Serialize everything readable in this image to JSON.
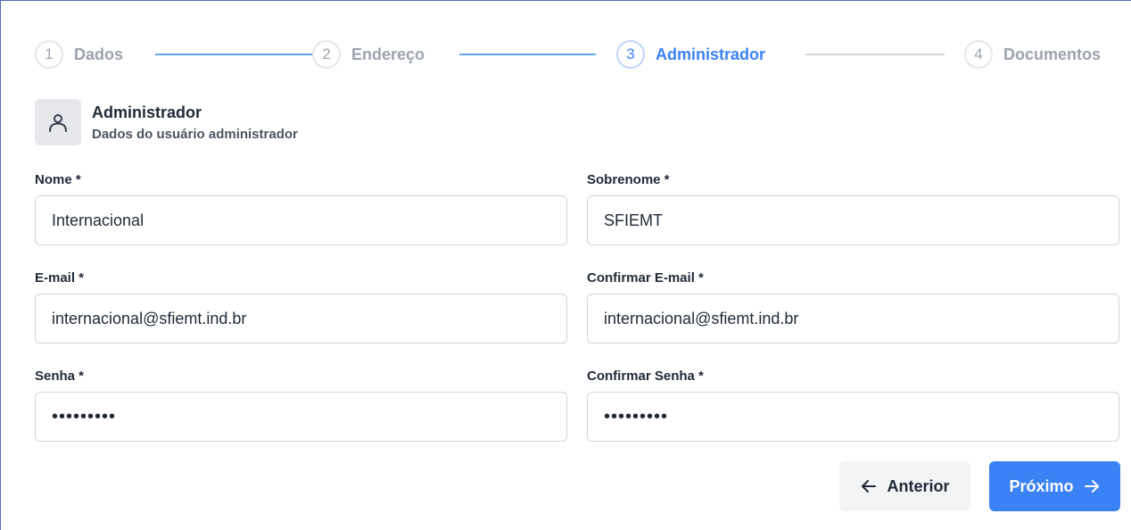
{
  "stepper": {
    "steps": [
      {
        "number": "1",
        "label": "Dados",
        "state": "complete"
      },
      {
        "number": "2",
        "label": "Endereço",
        "state": "complete"
      },
      {
        "number": "3",
        "label": "Administrador",
        "state": "active"
      },
      {
        "number": "4",
        "label": "Documentos",
        "state": "pending"
      }
    ]
  },
  "section": {
    "icon": "user-icon",
    "title": "Administrador",
    "subtitle": "Dados do usuário administrador"
  },
  "form": {
    "first_name": {
      "label": "Nome *",
      "value": "Internacional"
    },
    "last_name": {
      "label": "Sobrenome *",
      "value": "SFIEMT"
    },
    "email": {
      "label": "E-mail *",
      "value": "internacional@sfiemt.ind.br"
    },
    "confirm_email": {
      "label": "Confirmar E-mail *",
      "value": "internacional@sfiemt.ind.br"
    },
    "password": {
      "label": "Senha *",
      "value": "123456789"
    },
    "confirm_password": {
      "label": "Confirmar Senha *",
      "value": "123456789"
    }
  },
  "actions": {
    "previous_label": "Anterior",
    "next_label": "Próximo"
  },
  "colors": {
    "accent": "#3b82f6",
    "connector_complete": "#60a5fa",
    "connector_pending": "#d1d5db",
    "muted_text": "#9ca3af"
  }
}
